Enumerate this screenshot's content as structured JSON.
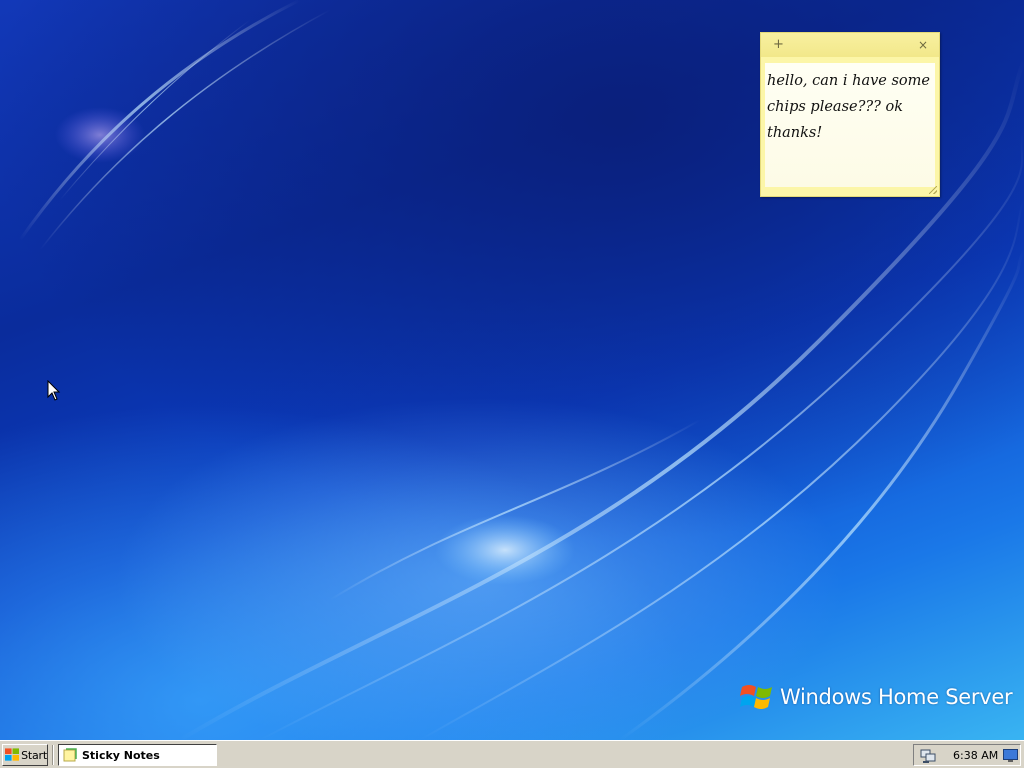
{
  "desktop": {
    "logo_text": "Windows Home Server"
  },
  "sticky_note": {
    "add_symbol": "+",
    "close_symbol": "×",
    "lines": [
      "hello, can i have some",
      "chips please??? ok",
      "thanks!"
    ],
    "background_color": "#fcf6a8"
  },
  "taskbar": {
    "start_label": "Start",
    "tasks": [
      {
        "label": "Sticky Notes",
        "icon": "sticky-notes-icon",
        "active": true
      }
    ],
    "tray": {
      "network_icon": "network-icon",
      "clock": "6:38 AM",
      "desktop_icon": "show-desktop-icon"
    }
  },
  "colors": {
    "taskbar": "#d8d4c8",
    "desktop_base": "#0b3fc6",
    "note_yellow": "#fcf6a8"
  }
}
